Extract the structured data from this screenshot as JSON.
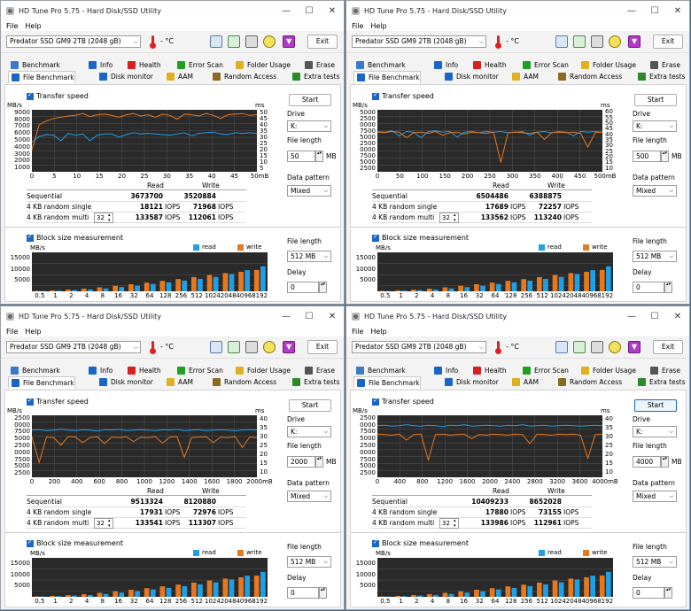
{
  "app_title": "HD Tune Pro 5.75 - Hard Disk/SSD Utility",
  "menu": {
    "file": "File",
    "help": "Help"
  },
  "drive": "Predator SSD GM9 2TB (2048 gB)",
  "temperature": "- °C",
  "exit_label": "Exit",
  "tabs_row1": [
    "Benchmark",
    "Info",
    "Health",
    "Error Scan",
    "Folder Usage",
    "Erase"
  ],
  "tabs_row2": [
    "File Benchmark",
    "Disk monitor",
    "AAM",
    "Random Access",
    "Extra tests"
  ],
  "transfer_label": "Transfer speed",
  "block_label": "Block size measurement",
  "mbs_unit": "MB/s",
  "ms_unit": "ms",
  "col_read": "Read",
  "col_write": "Write",
  "row_labels": [
    "Sequential",
    "4 KB random single",
    "4 KB random multi"
  ],
  "iops_suffix": "IOPS",
  "legend_read": "read",
  "legend_write": "write",
  "side": {
    "start": "Start",
    "drive_label": "Drive",
    "drive_value": "K:",
    "file_length_label": "File length",
    "mb_unit": "MB",
    "pattern_label": "Data pattern",
    "pattern_value": "Mixed",
    "block_file_length_label": "File length",
    "block_file_length_value": "512 MB",
    "delay_label": "Delay",
    "delay_value": "0"
  },
  "block_x_labels": [
    "0.5",
    "1",
    "2",
    "4",
    "8",
    "16",
    "32",
    "64",
    "128",
    "256",
    "512",
    "1024",
    "2048",
    "4096",
    "8192"
  ],
  "block_y_labels": [
    "15000",
    "10000",
    "5000"
  ],
  "colors": {
    "read": "#1f9fe6",
    "write": "#e8781e",
    "chart_bg": "#2a2a2a",
    "grid": "#555"
  },
  "windows": [
    {
      "file_length": "50",
      "queue": "32",
      "results": {
        "seq_read": "3673700",
        "seq_write": "3520884",
        "r4k_read": "18121",
        "r4k_write": "71968",
        "m4k_read": "133587",
        "m4k_write": "112061"
      },
      "y_labels_left": [
        "9000",
        "8000",
        "7000",
        "6000",
        "5000",
        "4000",
        "3000",
        "2000",
        "1000"
      ],
      "y_labels_right": [
        "50",
        "45",
        "40",
        "35",
        "30",
        "25",
        "20",
        "15",
        "10",
        "5"
      ],
      "x_labels": [
        "0",
        "5",
        "10",
        "15",
        "20",
        "25",
        "30",
        "35",
        "40",
        "45",
        "50mB"
      ],
      "start_focused": false,
      "chart_data": {
        "type": "line",
        "x_max": 50,
        "y_max": 10000,
        "series": [
          {
            "name": "read",
            "values": [
              4800,
              5700,
              6000,
              5900,
              5000,
              6200,
              5900,
              6100,
              5000,
              5900,
              6100,
              6100,
              5600,
              6000,
              6300,
              6100,
              6200,
              6100,
              6000,
              5900,
              6100,
              6300,
              5800,
              6200,
              6300,
              6400,
              6100,
              6000,
              6300,
              6200,
              6300,
              6200
            ]
          },
          {
            "name": "write",
            "values": [
              3500,
              7600,
              8200,
              8600,
              8800,
              9000,
              9100,
              9400,
              8900,
              9200,
              9300,
              9100,
              8800,
              9200,
              9400,
              9000,
              9200,
              8800,
              9300,
              9100,
              8500,
              9300,
              9200,
              9000,
              9400,
              9100,
              8600,
              9200,
              9300,
              9400,
              9100,
              9200
            ]
          }
        ]
      }
    },
    {
      "file_length": "500",
      "queue": "32",
      "results": {
        "seq_read": "6504486",
        "seq_write": "6388875",
        "r4k_read": "17689",
        "r4k_write": "72257",
        "m4k_read": "133562",
        "m4k_write": "113240"
      },
      "y_labels_left": [
        "5000",
        "2500",
        "0000",
        "7500",
        "5000",
        "2500",
        "0000",
        "7500",
        "5000",
        "2500"
      ],
      "y_labels_right": [
        "60",
        "55",
        "50",
        "45",
        "40",
        "35",
        "30",
        "25",
        "20",
        "15",
        "10"
      ],
      "x_labels": [
        "0",
        "50",
        "100",
        "150",
        "200",
        "250",
        "300",
        "350",
        "400",
        "450",
        "500mB"
      ],
      "start_focused": false,
      "chart_data": {
        "type": "line",
        "x_max": 500,
        "y_max": 10000,
        "series": [
          {
            "name": "read",
            "values": [
              6500,
              6400,
              6600,
              5800,
              6500,
              6400,
              5500,
              6500,
              6600,
              6400,
              6500,
              5600,
              6400,
              6500,
              6300,
              6500,
              6400,
              6500,
              6300,
              6400,
              6500,
              5900,
              6400,
              6500,
              6300,
              6500,
              6400,
              5800,
              6500,
              6400,
              6500,
              6400
            ]
          },
          {
            "name": "write",
            "values": [
              6400,
              6300,
              6500,
              6400,
              5500,
              6300,
              6400,
              6200,
              6500,
              5900,
              6300,
              6400,
              6100,
              6400,
              6300,
              6200,
              6400,
              1500,
              6300,
              6400,
              6300,
              6200,
              6400,
              5200,
              6300,
              6400,
              6300,
              6400,
              6200,
              4000,
              6300,
              6400
            ]
          }
        ]
      }
    },
    {
      "file_length": "2000",
      "queue": "32",
      "results": {
        "seq_read": "9513324",
        "seq_write": "8120880",
        "r4k_read": "17931",
        "r4k_write": "72976",
        "m4k_read": "133541",
        "m4k_write": "113307"
      },
      "y_labels_left": [
        "2500",
        "0000",
        "7500",
        "5000",
        "2500",
        "0000",
        "7500",
        "5000",
        "2500"
      ],
      "y_labels_right": [
        "40",
        "35",
        "30",
        "25",
        "20",
        "15",
        "10"
      ],
      "x_labels": [
        "0",
        "200",
        "400",
        "600",
        "800",
        "1000",
        "1200",
        "1400",
        "1600",
        "1800",
        "2000mB"
      ],
      "start_focused": false,
      "chart_data": {
        "type": "line",
        "x_max": 2000,
        "y_max": 12500,
        "series": [
          {
            "name": "read",
            "values": [
              9500,
              9600,
              9400,
              9500,
              9700,
              9500,
              9400,
              9600,
              9500,
              9300,
              9600,
              9500,
              9700,
              9400,
              9500,
              9600,
              9500,
              9400,
              9600,
              9500,
              9700,
              9400,
              9500,
              9600,
              9400,
              9500,
              9600,
              9500,
              9400,
              9500,
              9600,
              9500
            ]
          },
          {
            "name": "write",
            "values": [
              8200,
              3000,
              8100,
              8000,
              6500,
              8200,
              8100,
              7000,
              8000,
              8200,
              6800,
              8100,
              8000,
              8200,
              7200,
              8100,
              8000,
              8200,
              6900,
              8100,
              8200,
              4000,
              8000,
              8100,
              8200,
              7000,
              8100,
              8000,
              8200,
              6000,
              8100,
              8000
            ]
          }
        ]
      }
    },
    {
      "file_length": "4000",
      "queue": "32",
      "results": {
        "seq_read": "10409233",
        "seq_write": "8652028",
        "r4k_read": "17880",
        "r4k_write": "73155",
        "m4k_read": "133986",
        "m4k_write": "112961"
      },
      "y_labels_left": [
        "2500",
        "0000",
        "7500",
        "5000",
        "2500",
        "0000",
        "7500",
        "5000",
        "2500"
      ],
      "y_labels_right": [
        "40",
        "35",
        "30",
        "25",
        "20",
        "15",
        "10"
      ],
      "x_labels": [
        "0",
        "400",
        "800",
        "1200",
        "1600",
        "2000",
        "2400",
        "2800",
        "3200",
        "3600",
        "4000mB"
      ],
      "start_focused": true,
      "chart_data": {
        "type": "line",
        "x_max": 4000,
        "y_max": 12500,
        "series": [
          {
            "name": "read",
            "values": [
              10400,
              10500,
              10300,
              10400,
              10600,
              10400,
              10300,
              10500,
              10400,
              10200,
              10500,
              10400,
              10600,
              10300,
              10400,
              10500,
              10400,
              10300,
              10500,
              10400,
              10600,
              10300,
              10400,
              10500,
              10300,
              10400,
              10500,
              10400,
              10300,
              10400,
              10500,
              10400
            ]
          },
          {
            "name": "write",
            "values": [
              8700,
              8600,
              8500,
              8700,
              7500,
              8600,
              8700,
              3500,
              8600,
              8700,
              8500,
              8600,
              8700,
              7800,
              8600,
              8500,
              8700,
              8600,
              8500,
              8700,
              8600,
              6800,
              8700,
              8600,
              8500,
              8700,
              8600,
              8700,
              8500,
              3800,
              8600,
              8700
            ]
          }
        ]
      }
    }
  ],
  "block_chart_data": {
    "type": "bar",
    "categories": [
      "0.5",
      "1",
      "2",
      "4",
      "8",
      "16",
      "32",
      "64",
      "128",
      "256",
      "512",
      "1024",
      "2048",
      "4096",
      "8192"
    ],
    "y_max": 17500,
    "series": [
      {
        "name": "read",
        "values": [
          150,
          300,
          550,
          850,
          1300,
          1900,
          2600,
          3300,
          4000,
          4800,
          5600,
          6500,
          7800,
          9500,
          11200
        ]
      },
      {
        "name": "write",
        "values": [
          200,
          450,
          800,
          1200,
          1800,
          2500,
          3200,
          3900,
          4700,
          5500,
          6400,
          7300,
          8200,
          8800,
          9600
        ]
      }
    ]
  }
}
